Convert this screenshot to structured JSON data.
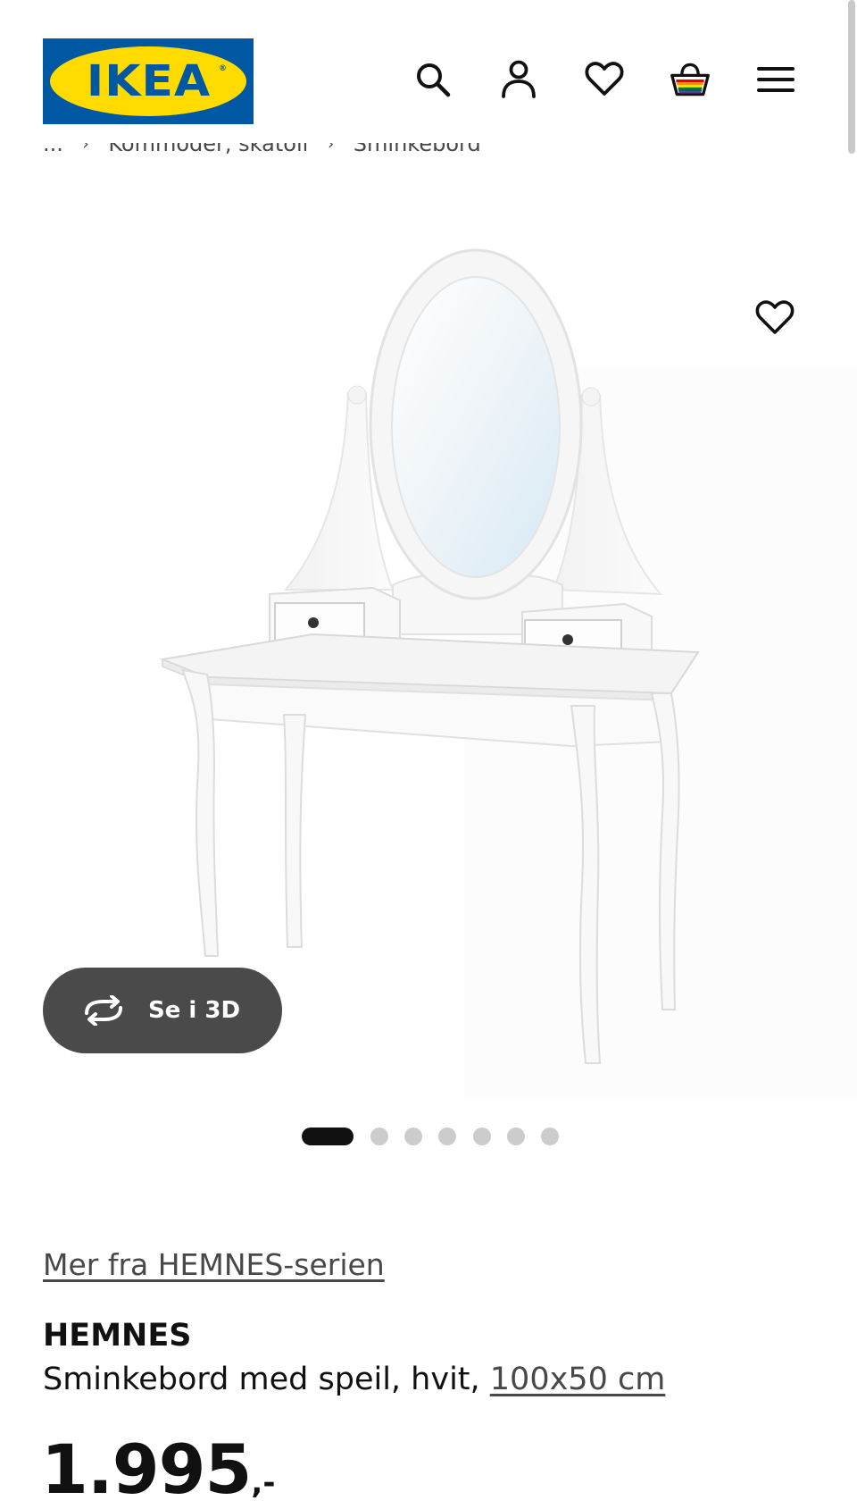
{
  "header": {
    "logo_text": "IKEA",
    "logo_registered": "®",
    "icons": [
      "search-icon",
      "account-icon",
      "heart-icon",
      "cart-icon",
      "menu-icon"
    ]
  },
  "breadcrumb": {
    "ellipsis": "...",
    "items": [
      "Kommoder, skatoll",
      "Sminkebord"
    ],
    "separator": "›"
  },
  "gallery": {
    "image_subject": "HEMNES sminkebord med speil, hvit",
    "see_3d_label": "Se i 3D",
    "slides": 7,
    "active_slide": 1
  },
  "product": {
    "series_link": "Mer fra HEMNES-serien",
    "name": "HEMNES",
    "description": "Sminkebord med speil, hvit, ",
    "size": "100x50 cm",
    "price_int": "1.995",
    "price_suffix": ",-"
  },
  "colors": {
    "ikea_blue": "#0058a3",
    "ikea_yellow": "#ffdb00",
    "dark_button": "#4a4a4a",
    "text": "#111111",
    "link": "#484848"
  }
}
